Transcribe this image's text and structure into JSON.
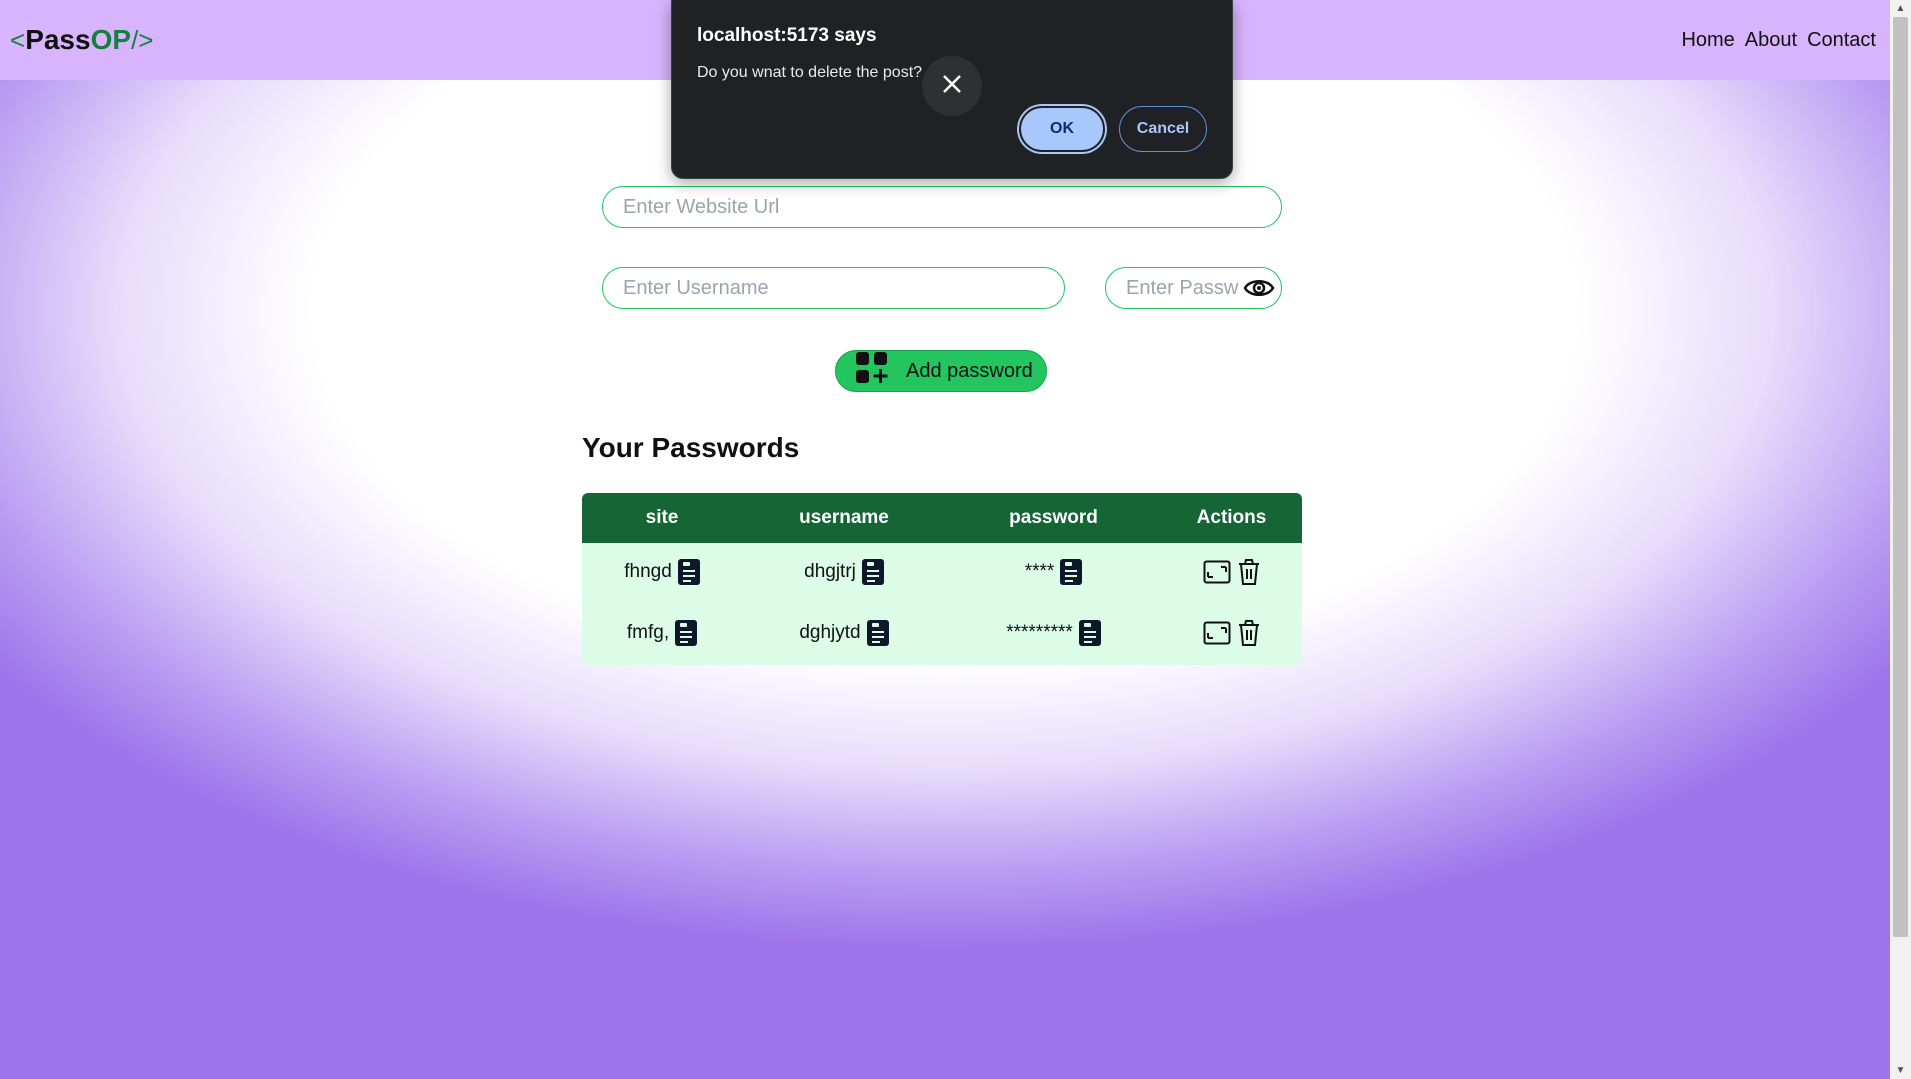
{
  "navbar": {
    "logo": {
      "open": "<",
      "pass": "Pass",
      "op": "OP",
      "close": "/>"
    },
    "links": [
      "Home",
      "About",
      "Contact"
    ]
  },
  "form": {
    "url_placeholder": "Enter Website Url",
    "username_placeholder": "Enter Username",
    "password_placeholder": "Enter Password",
    "add_button_label": "Add password"
  },
  "passwords": {
    "heading": "Your Passwords",
    "columns": [
      "site",
      "username",
      "password",
      "Actions"
    ],
    "rows": [
      {
        "site": "fhngd",
        "username": "dhgjtrj",
        "password": "****"
      },
      {
        "site": "fmfg,",
        "username": "dghjytd",
        "password": "*********"
      }
    ]
  },
  "dialog": {
    "title": "localhost:5173 says",
    "message": "Do you wnat to delete the post?",
    "ok_label": "OK",
    "cancel_label": "Cancel"
  },
  "colors": {
    "navbar_bg": "#d8b4fe",
    "accent_green": "#22c55e",
    "table_header": "#166534",
    "table_body": "#dcfce7",
    "dialog_bg": "#202124",
    "dialog_ok": "#a8c7fa"
  },
  "icons": {
    "add": "grid-plus-icon",
    "toggle_password": "eye-icon",
    "copy": "clipboard-icon",
    "edit": "edit-icon",
    "delete": "trash-icon",
    "dialog_close": "close-icon"
  }
}
